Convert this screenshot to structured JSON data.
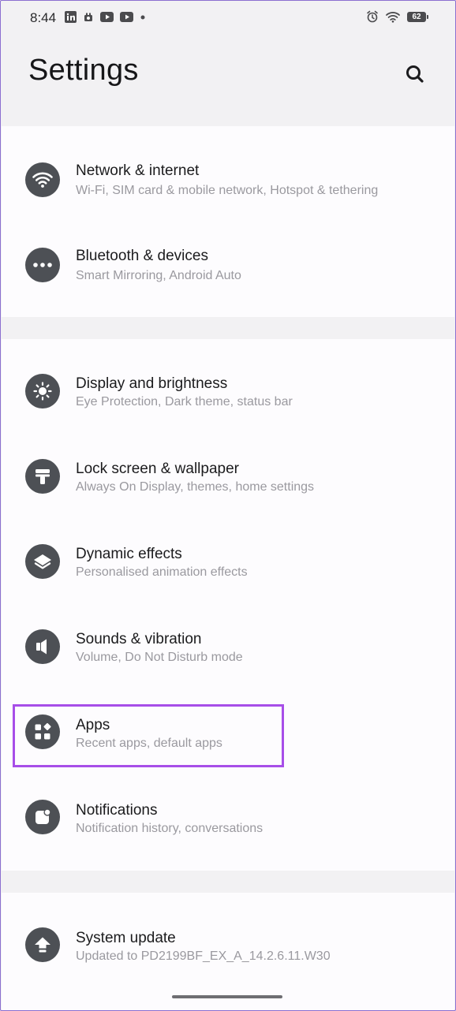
{
  "status_bar": {
    "time": "8:44",
    "left_icons": [
      "linkedin-icon",
      "camera-app-icon",
      "youtube-icon",
      "youtube-icon",
      "dot-icon"
    ],
    "right_icons": [
      "alarm-icon",
      "wifi-icon"
    ],
    "battery": "62"
  },
  "header": {
    "title": "Settings",
    "search_icon": "search-icon"
  },
  "groups": [
    {
      "items": [
        {
          "title": "Network & internet",
          "subtitle": "Wi-Fi, SIM card & mobile network, Hotspot & tethering",
          "icon": "wifi-icon"
        },
        {
          "title": "Bluetooth & devices",
          "subtitle": "Smart Mirroring, Android Auto",
          "icon": "more-dots-icon"
        }
      ]
    },
    {
      "items": [
        {
          "title": "Display and brightness",
          "subtitle": "Eye Protection, Dark theme, status bar",
          "icon": "brightness-icon"
        },
        {
          "title": "Lock screen & wallpaper",
          "subtitle": "Always On Display, themes, home settings",
          "icon": "paint-roller-icon"
        },
        {
          "title": "Dynamic effects",
          "subtitle": "Personalised animation effects",
          "icon": "layers-icon"
        },
        {
          "title": "Sounds & vibration",
          "subtitle": "Volume, Do Not Disturb mode",
          "icon": "speaker-icon"
        },
        {
          "title": "Apps",
          "subtitle": "Recent apps, default apps",
          "icon": "apps-grid-icon"
        },
        {
          "title": "Notifications",
          "subtitle": "Notification history, conversations",
          "icon": "notification-badge-icon"
        }
      ]
    },
    {
      "items": [
        {
          "title": "System update",
          "subtitle": "Updated to PD2199BF_EX_A_14.2.6.11.W30",
          "icon": "update-arrow-icon"
        }
      ]
    }
  ],
  "highlighted_item": "Apps",
  "colors": {
    "highlight": "#a74ee8",
    "icon_bg": "#4d5055",
    "background": "#f2f1f3",
    "card": "#fdfcfe"
  }
}
